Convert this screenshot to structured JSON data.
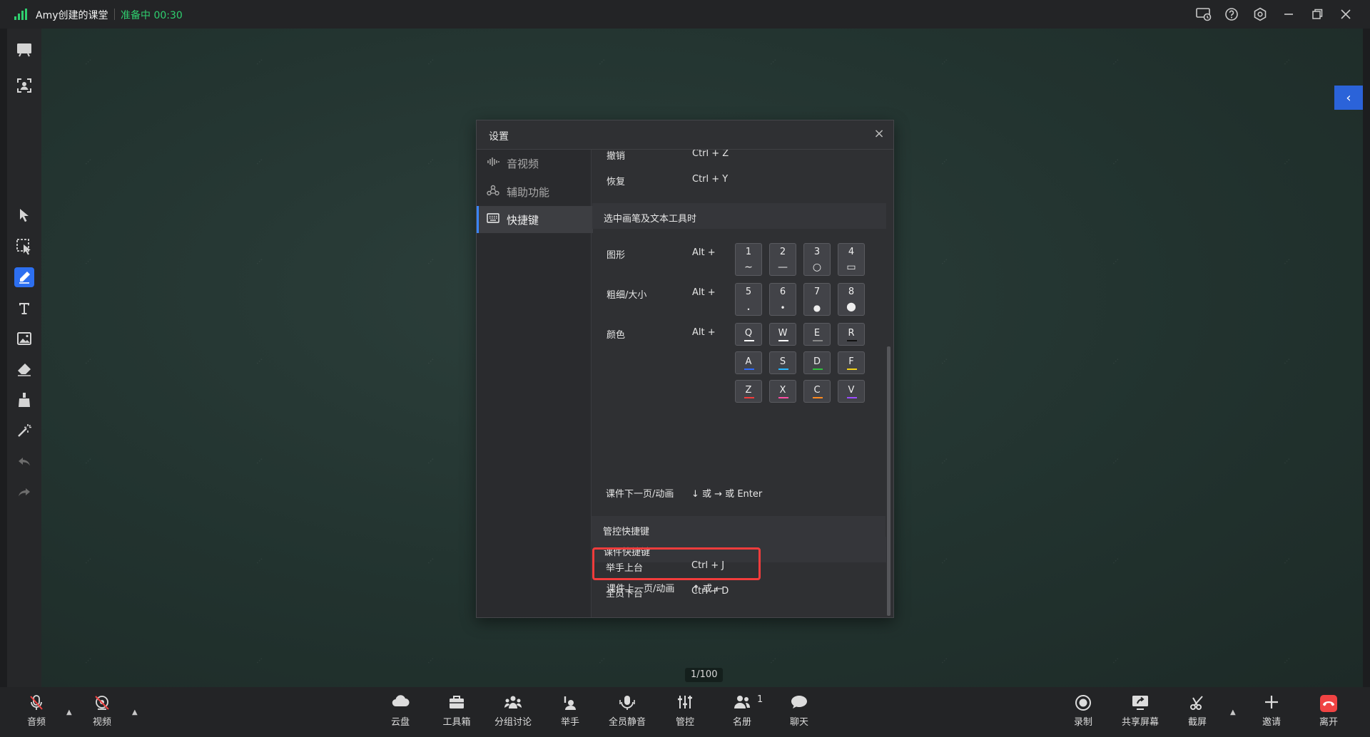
{
  "titlebar": {
    "app_title": "Amy创建的课堂",
    "status": "准备中 00:30",
    "icons": [
      "network-check-icon",
      "help-icon",
      "settings-icon",
      "minimize-icon",
      "restore-icon",
      "close-icon"
    ]
  },
  "left_toolbar": {
    "items": [
      "whiteboard-icon",
      "member-view-icon",
      "select-icon",
      "area-select-icon",
      "pen-icon",
      "text-icon",
      "image-icon",
      "eraser-icon",
      "clear-icon",
      "laser-icon",
      "undo-icon",
      "redo-icon"
    ],
    "active": "pen-icon"
  },
  "board": {
    "page_indicator": "1/100",
    "collapse_glyph": "‹"
  },
  "dialog": {
    "title": "设置",
    "close": "×",
    "nav": [
      {
        "label": "音视频",
        "icon": "audio-video-icon"
      },
      {
        "label": "辅助功能",
        "icon": "accessibility-icon"
      },
      {
        "label": "快捷键",
        "icon": "keyboard-icon",
        "active": true
      }
    ],
    "general": [
      {
        "label": "撤销",
        "key": "Ctrl + Z"
      },
      {
        "label": "恢复",
        "key": "Ctrl + Y"
      }
    ],
    "pen_section": {
      "title": "选中画笔及文本工具时",
      "shape_label": "图形",
      "shape_key": "Alt +",
      "shapes": [
        {
          "key": "1",
          "glyph": "∼"
        },
        {
          "key": "2",
          "glyph": "—"
        },
        {
          "key": "3",
          "glyph": "○"
        },
        {
          "key": "4",
          "glyph": "▭"
        }
      ],
      "size_label": "粗细/大小",
      "size_key": "Alt +",
      "sizes": [
        {
          "key": "5",
          "glyph": "•"
        },
        {
          "key": "6",
          "glyph": "•"
        },
        {
          "key": "7",
          "glyph": "●"
        },
        {
          "key": "8",
          "glyph": "●"
        }
      ],
      "color_label": "颜色",
      "color_key": "Alt +",
      "colors": [
        {
          "key": "Q",
          "color": "#ffffff"
        },
        {
          "key": "W",
          "color": "#ffffff"
        },
        {
          "key": "E",
          "color": "#8a8a8a"
        },
        {
          "key": "R",
          "color": "#111111"
        },
        {
          "key": "A",
          "color": "#2f6bff"
        },
        {
          "key": "S",
          "color": "#27b7ff"
        },
        {
          "key": "D",
          "color": "#2fc03c"
        },
        {
          "key": "F",
          "color": "#f2d21a"
        },
        {
          "key": "Z",
          "color": "#f23c3c"
        },
        {
          "key": "X",
          "color": "#ff4fa3"
        },
        {
          "key": "C",
          "color": "#ff8a1f"
        },
        {
          "key": "V",
          "color": "#9b4dff"
        }
      ]
    },
    "courseware_section": {
      "title": "课件快捷键",
      "rows": [
        {
          "label": "课件上一页/动画",
          "key": "↑ 或 ←"
        },
        {
          "label": "课件下一页/动画",
          "key": "↓ 或 → 或 Enter"
        }
      ]
    },
    "control_section": {
      "title": "管控快捷键",
      "rows": [
        {
          "label": "举手上台",
          "key": "Ctrl + J"
        },
        {
          "label": "全员下台",
          "key": "Ctrl + D"
        }
      ]
    }
  },
  "bottom_bar": {
    "left": [
      {
        "label": "音频",
        "icon": "mic-muted-icon"
      },
      {
        "label": "视频",
        "icon": "camera-off-icon"
      }
    ],
    "center": [
      {
        "label": "云盘",
        "icon": "cloud-icon"
      },
      {
        "label": "工具箱",
        "icon": "toolbox-icon"
      },
      {
        "label": "分组讨论",
        "icon": "group-icon"
      },
      {
        "label": "举手",
        "icon": "raise-hand-icon"
      },
      {
        "label": "全员静音",
        "icon": "mute-all-icon"
      },
      {
        "label": "管控",
        "icon": "control-icon"
      },
      {
        "label": "名册",
        "icon": "roster-icon",
        "badge": "1"
      },
      {
        "label": "聊天",
        "icon": "chat-icon"
      }
    ],
    "right": [
      {
        "label": "录制",
        "icon": "record-icon"
      },
      {
        "label": "共享屏幕",
        "icon": "share-screen-icon"
      },
      {
        "label": "截屏",
        "icon": "screenshot-icon"
      },
      {
        "label": "邀请",
        "icon": "invite-icon"
      },
      {
        "label": "离开",
        "icon": "leave-icon"
      }
    ],
    "caret": "▲"
  }
}
